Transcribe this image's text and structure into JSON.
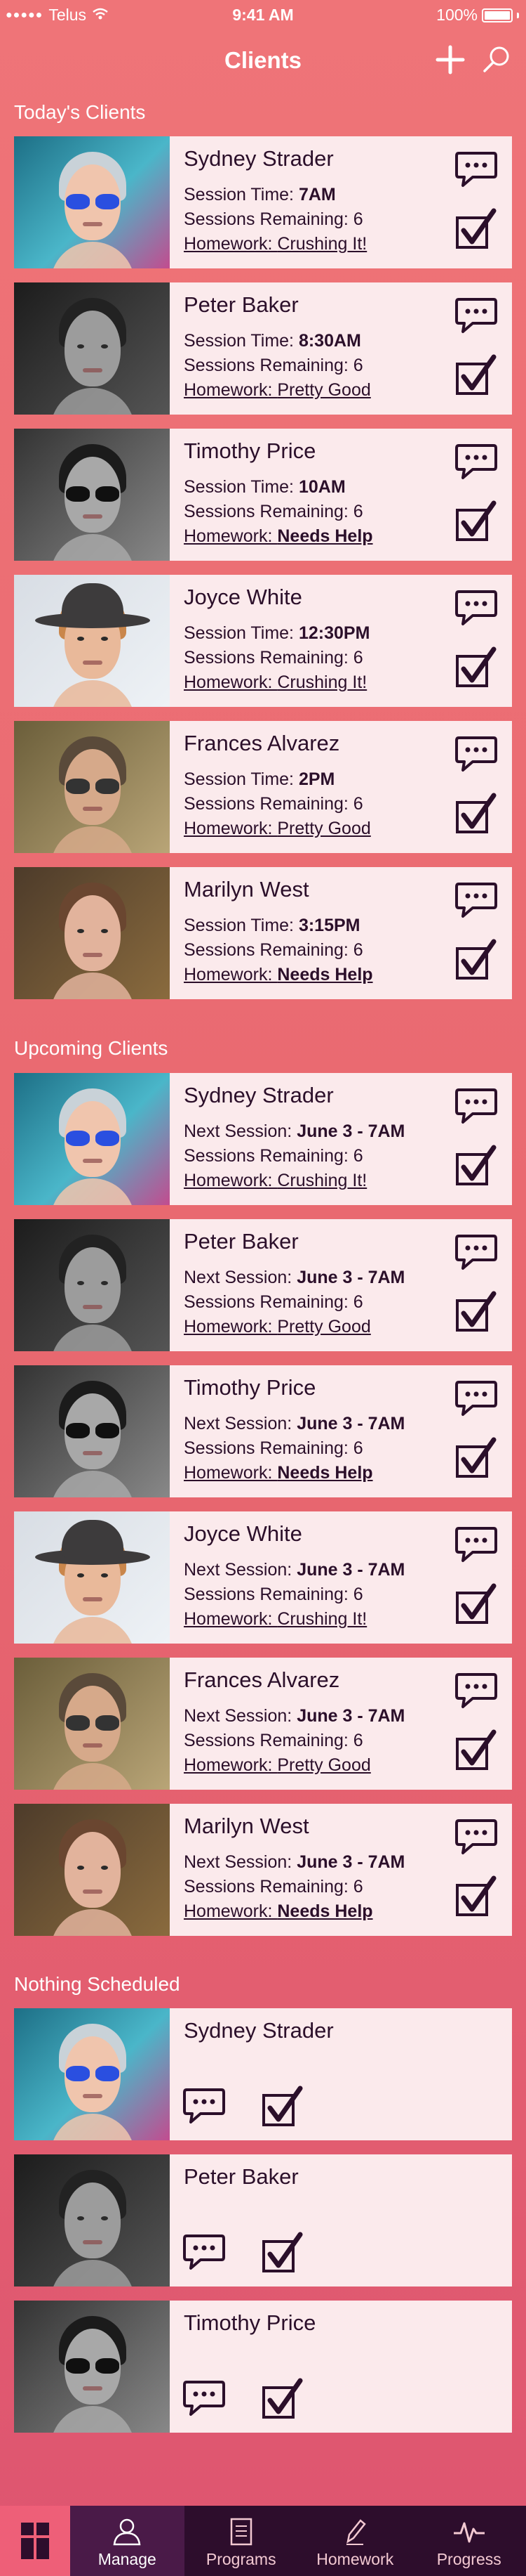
{
  "status_bar": {
    "carrier": "Telus",
    "time": "9:41 AM",
    "battery": "100%"
  },
  "header": {
    "title": "Clients"
  },
  "sections": {
    "today": {
      "title": "Today's Clients"
    },
    "upcoming": {
      "title": "Upcoming Clients"
    },
    "nothing": {
      "title": "Nothing Scheduled"
    }
  },
  "today_clients": [
    {
      "name": "Sydney Strader",
      "session_label": "Session Time: ",
      "session_value": "7AM",
      "remaining": "Sessions Remaining: 6",
      "hw_label": "Homework: ",
      "hw_value": "Crushing It!"
    },
    {
      "name": "Peter Baker",
      "session_label": "Session Time: ",
      "session_value": "8:30AM",
      "remaining": "Sessions Remaining: 6",
      "hw_label": "Homework: ",
      "hw_value": "Pretty Good"
    },
    {
      "name": "Timothy Price",
      "session_label": "Session Time: ",
      "session_value": "10AM",
      "remaining": "Sessions Remaining: 6",
      "hw_label": "Homework: ",
      "hw_value": "Needs Help"
    },
    {
      "name": "Joyce White",
      "session_label": "Session Time: ",
      "session_value": "12:30PM",
      "remaining": "Sessions Remaining: 6",
      "hw_label": "Homework: ",
      "hw_value": "Crushing It!"
    },
    {
      "name": "Frances Alvarez",
      "session_label": "Session Time: ",
      "session_value": "2PM",
      "remaining": "Sessions Remaining: 6",
      "hw_label": "Homework: ",
      "hw_value": "Pretty Good"
    },
    {
      "name": "Marilyn West",
      "session_label": "Session Time: ",
      "session_value": "3:15PM",
      "remaining": "Sessions Remaining: 6",
      "hw_label": "Homework: ",
      "hw_value": "Needs Help"
    }
  ],
  "upcoming_clients": [
    {
      "name": "Sydney Strader",
      "session_label": "Next Session: ",
      "session_value": "June 3 - 7AM",
      "remaining": "Sessions Remaining: 6",
      "hw_label": "Homework: ",
      "hw_value": "Crushing It!"
    },
    {
      "name": "Peter Baker",
      "session_label": "Next Session: ",
      "session_value": "June 3 - 7AM",
      "remaining": "Sessions Remaining: 6",
      "hw_label": "Homework: ",
      "hw_value": "Pretty Good"
    },
    {
      "name": "Timothy Price",
      "session_label": "Next Session: ",
      "session_value": "June 3 - 7AM",
      "remaining": "Sessions Remaining: 6",
      "hw_label": "Homework: ",
      "hw_value": "Needs Help"
    },
    {
      "name": "Joyce White",
      "session_label": "Next Session: ",
      "session_value": "June 3 - 7AM",
      "remaining": "Sessions Remaining: 6",
      "hw_label": "Homework: ",
      "hw_value": "Crushing It!"
    },
    {
      "name": "Frances Alvarez",
      "session_label": "Next Session: ",
      "session_value": "June 3 - 7AM",
      "remaining": "Sessions Remaining: 6",
      "hw_label": "Homework: ",
      "hw_value": "Pretty Good"
    },
    {
      "name": "Marilyn West",
      "session_label": "Next Session: ",
      "session_value": "June 3 - 7AM",
      "remaining": "Sessions Remaining: 6",
      "hw_label": "Homework: ",
      "hw_value": "Needs Help"
    }
  ],
  "unscheduled_clients": [
    {
      "name": "Sydney Strader"
    },
    {
      "name": "Peter Baker"
    },
    {
      "name": "Timothy Price"
    }
  ],
  "tabbar": {
    "tabs": [
      {
        "label": "Manage",
        "icon": "person-icon"
      },
      {
        "label": "Programs",
        "icon": "document-icon"
      },
      {
        "label": "Homework",
        "icon": "pencil-icon"
      },
      {
        "label": "Progress",
        "icon": "heartbeat-icon"
      }
    ]
  },
  "colors": {
    "accent": "#e8676f",
    "card": "#fbeaec",
    "ink": "#2b0f2a",
    "tabbar": "#2d0d2c"
  }
}
